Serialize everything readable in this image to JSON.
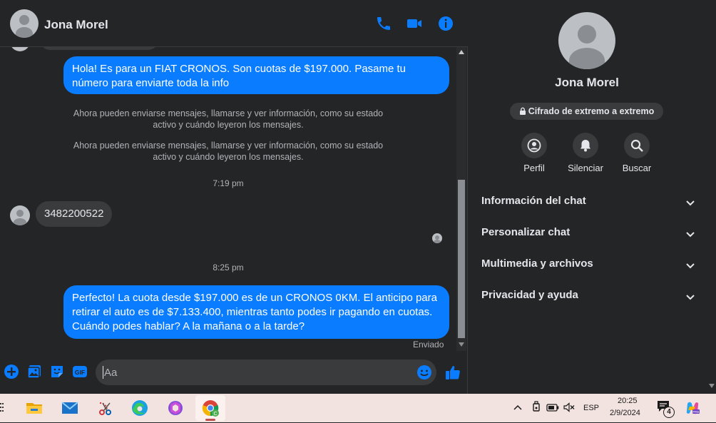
{
  "header": {
    "name": "Jona Morel"
  },
  "messages": {
    "msg1": "Hola! Es para un FIAT CRONOS. Son cuotas de $197.000. Pasame tu número para enviarte toda la info",
    "sys1": "Ahora pueden enviarse mensajes, llamarse y ver información, como su estado activo y cuándo leyeron los mensajes.",
    "sys2": "Ahora pueden enviarse mensajes, llamarse y ver información, como su estado activo y cuándo leyeron los mensajes.",
    "time1": "7:19 pm",
    "msg2": "3482200522",
    "time2": "8:25 pm",
    "msg3": "Perfecto! La cuota desde $197.000 es de un CRONOS 0KM. El anticipo para retirar el auto es de $7.133.400, mientras tanto podes ir pagando en cuotas. Cuándo podes hablar? A la mañana o a la tarde?",
    "status": "Enviado"
  },
  "composer": {
    "placeholder": "Aa"
  },
  "sidebar": {
    "name": "Jona Morel",
    "encryption": "Cifrado de extremo a extremo",
    "actions": [
      "Perfil",
      "Silenciar",
      "Buscar"
    ],
    "sections": [
      "Información del chat",
      "Personalizar chat",
      "Multimedia y archivos",
      "Privacidad y ayuda"
    ]
  },
  "taskbar": {
    "lang": "ESP",
    "time": "20:25",
    "date": "2/9/2024",
    "notif_count": "4"
  },
  "colors": {
    "accent": "#0a7cff",
    "bg": "#242526",
    "bubble_in": "#3a3b3c"
  }
}
